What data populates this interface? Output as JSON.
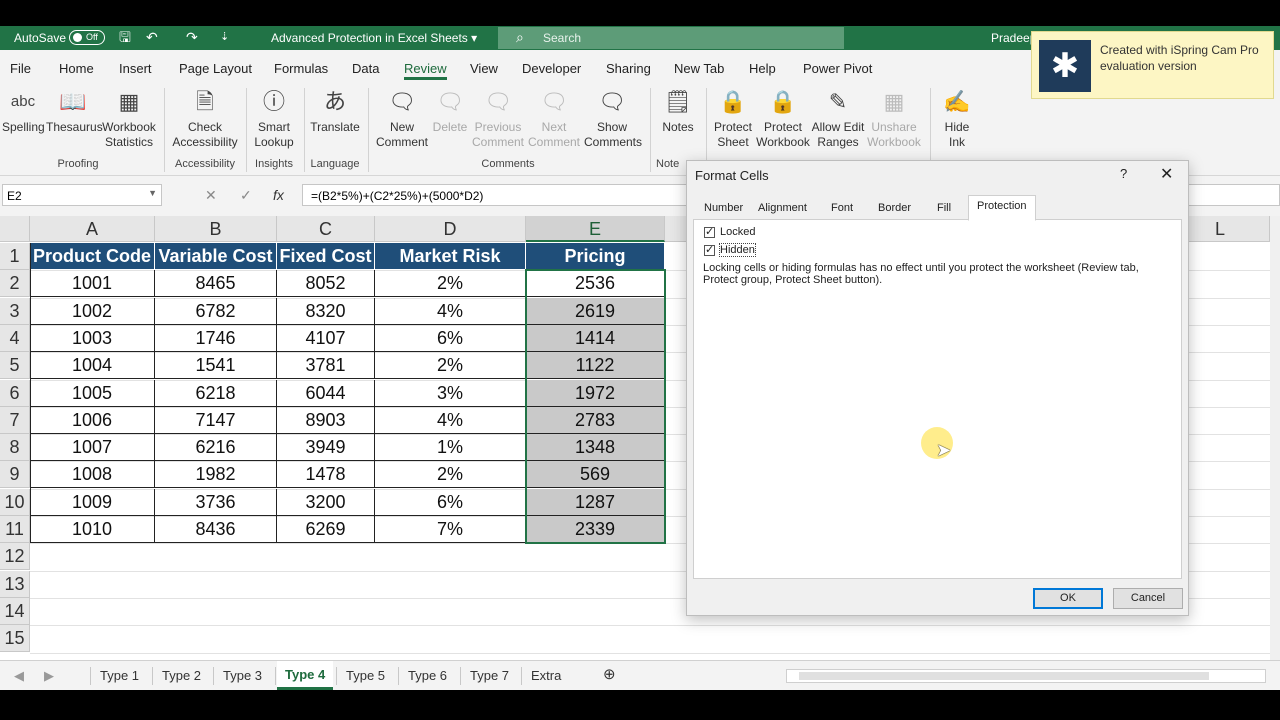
{
  "titlebar": {
    "autosave_label": "AutoSave",
    "autosave_state": "Off",
    "doc_title": "Advanced Protection in Excel Sheets",
    "title_chevron": "▾",
    "search_placeholder": "Search",
    "user": "Pradeep",
    "icons": [
      "save-icon",
      "undo-icon",
      "redo-icon",
      "customize-icon"
    ]
  },
  "menu": [
    "File",
    "Home",
    "Insert",
    "Page Layout",
    "Formulas",
    "Data",
    "Review",
    "View",
    "Developer",
    "Sharing",
    "New Tab",
    "Help",
    "Power Pivot"
  ],
  "menu_active": "Review",
  "ribbon": {
    "buttons": [
      {
        "label": "Spelling",
        "icon": "abc"
      },
      {
        "label": "Thesaurus",
        "icon": "📖"
      },
      {
        "label": "Workbook\nStatistics",
        "icon": "▦"
      },
      {
        "label": "Check\nAccessibility",
        "icon": "🗎"
      },
      {
        "label": "Smart\nLookup",
        "icon": "ⓘ"
      },
      {
        "label": "Translate",
        "icon": "あ"
      },
      {
        "label": "New\nComment",
        "icon": "🗨"
      },
      {
        "label": "Delete",
        "icon": "🗨"
      },
      {
        "label": "Previous\nComment",
        "icon": "🗨"
      },
      {
        "label": "Next\nComment",
        "icon": "🗨"
      },
      {
        "label": "Show\nComments",
        "icon": "🗨"
      },
      {
        "label": "Notes",
        "icon": "🗒"
      },
      {
        "label": "Protect\nSheet",
        "icon": "🔒"
      },
      {
        "label": "Protect\nWorkbook",
        "icon": "🔒"
      },
      {
        "label": "Allow Edit\nRanges",
        "icon": "✎"
      },
      {
        "label": "Unshare\nWorkbook",
        "icon": "▦"
      },
      {
        "label": "Hide\nInk",
        "icon": "✍"
      }
    ],
    "groups": [
      "Proofing",
      "Accessibility",
      "Insights",
      "Language",
      "Comments",
      "Note"
    ]
  },
  "formula_bar": {
    "name_box": "E2",
    "formula": "=(B2*5%)+(C2*25%)+(5000*D2)",
    "cancel_icon": "✕",
    "enter_icon": "✓",
    "fx_icon": "fx"
  },
  "grid": {
    "columns": [
      "A",
      "B",
      "C",
      "D",
      "E"
    ],
    "extra_column": "L",
    "rows": [
      "1",
      "2",
      "3",
      "4",
      "5",
      "6",
      "7",
      "8",
      "9",
      "10",
      "11",
      "12",
      "13",
      "14",
      "15"
    ],
    "headers": [
      "Product Code",
      "Variable Cost",
      "Fixed Cost",
      "Market Risk",
      "Pricing"
    ],
    "data": [
      [
        "1001",
        "8465",
        "8052",
        "2%",
        "2536"
      ],
      [
        "1002",
        "6782",
        "8320",
        "4%",
        "2619"
      ],
      [
        "1003",
        "1746",
        "4107",
        "6%",
        "1414"
      ],
      [
        "1004",
        "1541",
        "3781",
        "2%",
        "1122"
      ],
      [
        "1005",
        "6218",
        "6044",
        "3%",
        "1972"
      ],
      [
        "1006",
        "7147",
        "8903",
        "4%",
        "2783"
      ],
      [
        "1007",
        "6216",
        "3949",
        "1%",
        "1348"
      ],
      [
        "1008",
        "1982",
        "1478",
        "2%",
        "569"
      ],
      [
        "1009",
        "3736",
        "3200",
        "6%",
        "1287"
      ],
      [
        "1010",
        "8436",
        "6269",
        "7%",
        "2339"
      ]
    ]
  },
  "sheet_tabs": [
    "Type 1",
    "Type 2",
    "Type 3",
    "Type 4",
    "Type 5",
    "Type 6",
    "Type 7",
    "Extra"
  ],
  "active_sheet": "Type 4",
  "add_sheet_icon": "⊕",
  "dialog": {
    "title": "Format Cells",
    "help": "?",
    "close": "✕",
    "tabs": [
      "Number",
      "Alignment",
      "Font",
      "Border",
      "Fill",
      "Protection"
    ],
    "active_tab": "Protection",
    "locked_label": "Locked",
    "hidden_label": "Hidden",
    "note": "Locking cells or hiding formulas has no effect until you protect the worksheet (Review tab, Protect group, Protect Sheet button).",
    "ok": "OK",
    "cancel": "Cancel"
  },
  "watermark": {
    "line1": "Created with iSpring Cam Pro",
    "line2": "evaluation version",
    "logo_icon": "✱"
  },
  "colors": {
    "excel_green": "#217346",
    "header_fill": "#1f4e79",
    "pricing_fill": "#c9c9c9"
  }
}
